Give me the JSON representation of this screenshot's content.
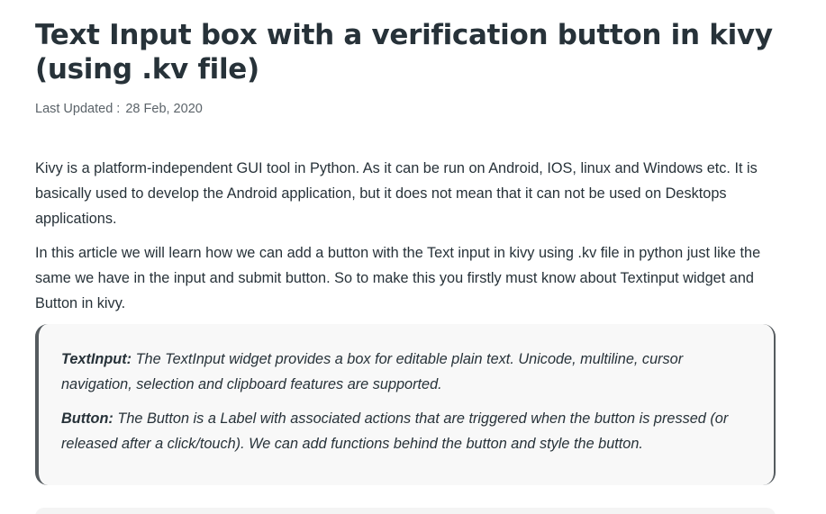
{
  "article": {
    "title": "Text Input box with a verification button in kivy (using .kv file)",
    "last_updated_label": "Last Updated :",
    "last_updated_date": "28 Feb, 2020",
    "paragraphs": [
      "Kivy is a platform-independent GUI tool in Python. As it can be run on Android, IOS, linux and Windows etc. It is basically used to develop the Android application, but it does not mean that it can not be used on Desktops applications.",
      "In this article we will learn how we can add a button with the Text input in kivy using .kv file in python just like the same we have in the input and submit button. So to make this you firstly must know about Textinput widget and Button in kivy."
    ],
    "note": {
      "items": [
        {
          "term": "TextInput:",
          "text": " The TextInput widget provides a box for editable plain text. Unicode, multiline, cursor navigation, selection and clipboard features are supported."
        },
        {
          "term": "Button:",
          "text": " The Button is a Label with associated actions that are triggered when the button is pressed (or released after a click/touch). We can add functions behind the button and style the button."
        }
      ]
    }
  }
}
